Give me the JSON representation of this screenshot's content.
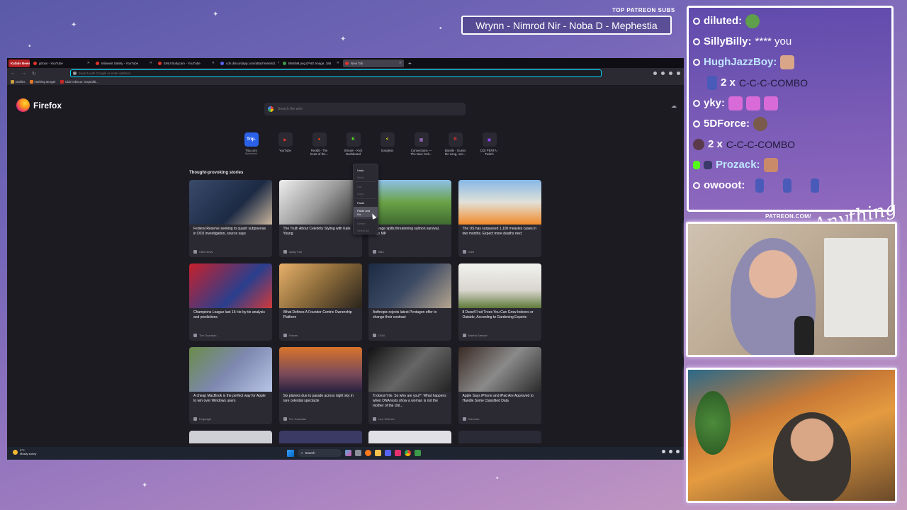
{
  "browser": {
    "tabs": [
      {
        "label": "Kafalis News",
        "fav": "",
        "first": true
      },
      {
        "label": "grtoss - YouTube",
        "fav": "r"
      },
      {
        "label": "Midwest Safety - YouTube",
        "fav": "r"
      },
      {
        "label": "EMU Bodycam - YouTube",
        "fav": "r"
      },
      {
        "label": "cdn.discordapp.com/attachments/1",
        "fav": "b"
      },
      {
        "label": "Bt6shM.png (PNG Image, 186",
        "fav": "g"
      },
      {
        "label": "New Tab",
        "fav": "r",
        "active": true
      }
    ],
    "url_placeholder": "Search with Google or enter address",
    "bookmarks": [
      "Dailies",
      "Nothing Burger",
      "Clair Obscur: Expediti..."
    ]
  },
  "newtab": {
    "brand": "Firefox",
    "search_placeholder": "Search the web",
    "shortcuts": [
      {
        "label": "Trip.com",
        "sub": "Sponsored",
        "glyph": "Trip.",
        "color": "#2a61e8"
      },
      {
        "label": "YouTube",
        "sub": "",
        "glyph": "▶",
        "color": "#e0342b"
      },
      {
        "label": "Reddit - The heart of the...",
        "sub": "",
        "glyph": "●",
        "color": "#ff4500"
      },
      {
        "label": "Stream - Kick Dashboard",
        "sub": "",
        "glyph": "K",
        "color": "#53fc18"
      },
      {
        "label": "Songless",
        "sub": "",
        "glyph": "<",
        "color": "#e8e21a"
      },
      {
        "label": "Connections — The New York...",
        "sub": "",
        "glyph": "▦",
        "color": "#b07ad9"
      },
      {
        "label": "Bandle - Guess the song, one...",
        "sub": "",
        "glyph": "B",
        "color": "#d8323a"
      },
      {
        "label": "(32) PENTA - Twitch",
        "sub": "",
        "glyph": "▣",
        "color": "#9146ff"
      }
    ],
    "stories_title": "Thought-provoking stories",
    "stories": [
      {
        "title": "Federal Reserve seeking to quash subpoenas in DOJ investigation, source says",
        "source": "CBS News",
        "bg": "linear-gradient(135deg,#3a4a6a,#1c2a44 60%,#c9b59c)"
      },
      {
        "title": "The Truth About Celebrity Styling with Kate Young",
        "source": "Vanity Fair",
        "bg": "linear-gradient(135deg,#eee,#999 50%,#222)"
      },
      {
        "title": "Sewage spills threatening salmon survival, says MP",
        "source": "BBC",
        "bg": "linear-gradient(180deg,#8fc0e8,#6aa247 50%,#3f6a30)"
      },
      {
        "title": "The US has surpassed 1,100 measles cases in two months. Expect more deaths next",
        "source": "CNN",
        "bg": "linear-gradient(180deg,#87b8e6,#e1e1d8 50%,#f28a2a)"
      },
      {
        "title": "Champions League last 16: tie-by-tie analysis and predictions",
        "source": "The Guardian",
        "bg": "linear-gradient(135deg,#c8202b,#2a3f8e 60%,#d13a3a)"
      },
      {
        "title": "What Defines A Founder-Centric Ownership Platform",
        "source": "Forbes",
        "bg": "linear-gradient(135deg,#e8b06a,#8a6a3a 50%,#2a241c)"
      },
      {
        "title": "Anthropic rejects latest Pentagon offer to change their contract",
        "source": "CNN",
        "bg": "linear-gradient(135deg,#1c2a44,#3e4b64 50%,#b5a58f)"
      },
      {
        "title": "8 Dwarf Fruit Trees You Can Grow Indoors or Outside, According to Gardening Experts",
        "source": "Martha Stewart",
        "bg": "linear-gradient(180deg,#f2f2ef,#d9d6cf 60%,#5f7a3a)"
      },
      {
        "title": "A cheap MacBook is the perfect way for Apple to win over Windows users",
        "source": "Engadget",
        "bg": "linear-gradient(135deg,#6a8c4a,#7e88b0 50%,#b8c4e6)"
      },
      {
        "title": "Six planets due to parade across night sky in rare celestial spectacle",
        "source": "The Guardian",
        "bg": "linear-gradient(180deg,#d9742a,#7a4a5a 60%,#2a2240)"
      },
      {
        "title": "'It doesn't lie. So who are you?': What happens when DNA tests show a woman is not the mother of the chil...",
        "source": "Live Science",
        "bg": "linear-gradient(135deg,#111,#666 50%,#222)"
      },
      {
        "title": "Apple Says iPhone and iPad Are Approved to Handle Some Classified Data",
        "source": "Gizmodo",
        "bg": "linear-gradient(135deg,#3a2a24,#8a8a8a 50%,#2a2a2a)"
      }
    ],
    "peek_colors": [
      "#cfcfd6",
      "#3a3a64",
      "#e0e0e6",
      "#2a2a36"
    ],
    "context_menu": [
      "Undo",
      "Redo",
      "Cut",
      "Copy",
      "Paste",
      "Paste and Go",
      "Delete",
      "Select All"
    ]
  },
  "taskbar": {
    "temp": "3°C",
    "weather": "Mostly sunny",
    "search_label": "Search"
  },
  "overlay": {
    "patreon_label": "TOP PATREON SUBS",
    "patreon_names": "Wrynn - Nimrod Nir - Noba D - Mephestia",
    "patreon_url": "PATREON.COM/",
    "signature": "Anything Else",
    "chat": {
      "l1_user": "diluted:",
      "l2_user": "SillyBilly:",
      "l2_msg": "**** you",
      "l3_user": "HughJazzBoy:",
      "l4_count": "2 x",
      "l4_text": "C-C-C-COMBO",
      "l5_user": "yky:",
      "l6_user": "5DForce:",
      "l7_count": "2 x",
      "l7_text": "C-C-C-COMBO",
      "l8_user": "Prozack:",
      "l9_user": "owooot:"
    }
  }
}
